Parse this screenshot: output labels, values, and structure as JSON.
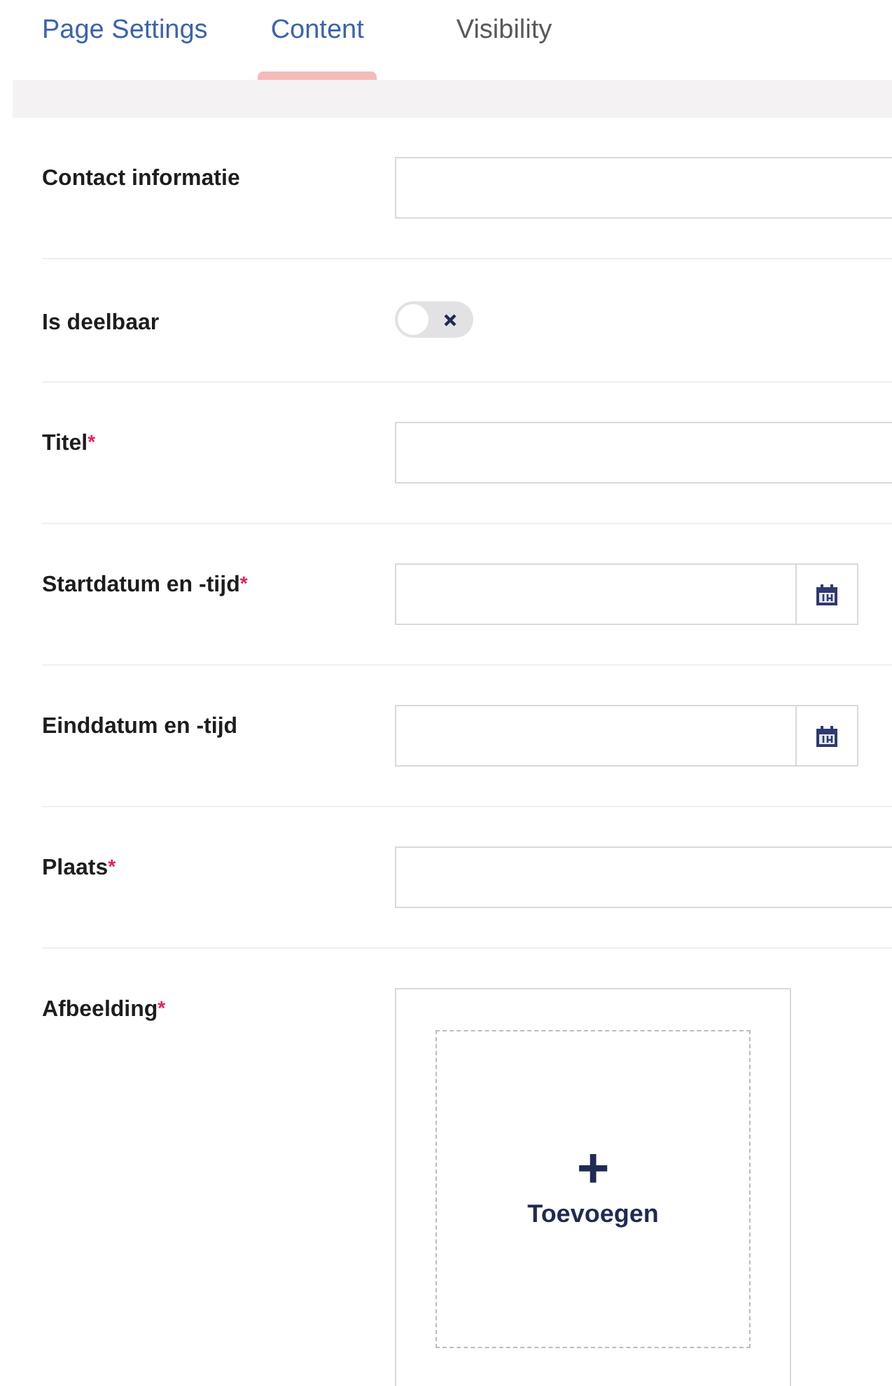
{
  "tabs": [
    {
      "label": "Page Settings",
      "selected": false,
      "color": "#3b63b0"
    },
    {
      "label": "Content",
      "selected": true,
      "color": "#3b63b0"
    },
    {
      "label": "Visibility",
      "selected": false,
      "color": "#5a5a5a"
    }
  ],
  "fields": [
    {
      "kind": "text",
      "label": "Contact informatie"
    },
    {
      "kind": "toggle",
      "label": "Is deelbaar",
      "on": false
    },
    {
      "kind": "text",
      "label": "Titel",
      "required_mark": "*"
    },
    {
      "kind": "date",
      "label": "Startdatum en -tijd",
      "required_mark": "*"
    },
    {
      "kind": "date",
      "label": "Einddatum en -tijd"
    },
    {
      "kind": "text",
      "label": "Plaats",
      "required_mark": "*"
    },
    {
      "kind": "image",
      "label": "Afbeelding",
      "required_mark": "*",
      "button": {
        "icon": "+",
        "label": "Toevoegen"
      }
    }
  ]
}
